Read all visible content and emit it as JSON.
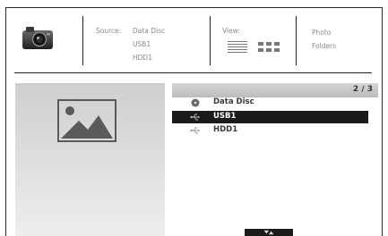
{
  "header": {
    "source_label": "Source:",
    "sources": [
      "Data Disc",
      "USB1",
      "HDD1"
    ],
    "view_label": "View:",
    "modes": [
      "Photo",
      "Folders"
    ]
  },
  "list": {
    "page_indicator": "2 / 3",
    "items": [
      {
        "label": "Data Disc",
        "icon": "disc-icon"
      },
      {
        "label": "USB1",
        "icon": "usb-icon"
      },
      {
        "label": "HDD1",
        "icon": "usb-icon"
      }
    ],
    "selected_index": 1
  },
  "icons": {
    "camera": "camera-icon",
    "list_view": "list-view-icon",
    "grid_view": "grid-view-icon",
    "preview": "image-placeholder-icon",
    "scroll": "scroll-arrows-icon"
  },
  "colors": {
    "selected_row": "#1b1b1b",
    "header_bar": "#c9c9c9",
    "text": "#8a8a8a"
  }
}
